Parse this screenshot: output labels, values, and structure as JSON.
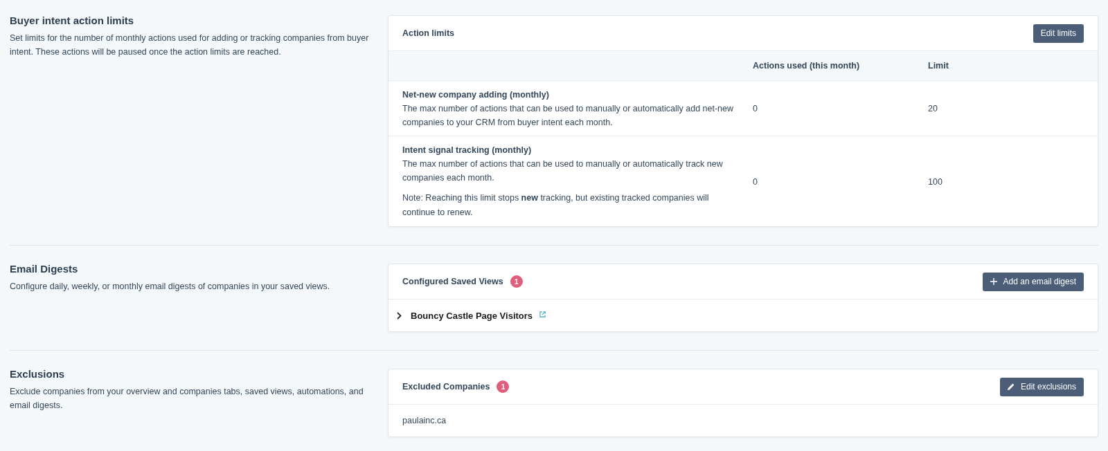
{
  "sections": [
    {
      "kind": "limits",
      "title": "Buyer intent action limits",
      "description": "Set limits for the number of monthly actions used for adding or tracking companies from buyer intent. These actions will be paused once the action limits are reached.",
      "card": {
        "title": "Action limits",
        "button": "Edit limits",
        "columns": [
          "Actions used (this month)",
          "Limit"
        ],
        "rows": [
          {
            "name": "Net-new company adding (monthly)",
            "description": "The max number of actions that can be used to manually or automatically add net-new companies to your CRM from buyer intent each month.",
            "actions_used": "0",
            "limit": "20"
          },
          {
            "name": "Intent signal tracking (monthly)",
            "description": "The max number of actions that can be used to manually or automatically track new companies each month.",
            "note": "Note: Reaching this limit stops **new** tracking, but existing tracked companies will continue to renew.",
            "actions_used": "0",
            "limit": "100"
          }
        ]
      }
    },
    {
      "kind": "digests",
      "title": "Email Digests",
      "description": "Configure daily, weekly, or monthly email digests of companies in your saved views.",
      "card": {
        "title": "Configured Saved Views",
        "badge": "1",
        "button": "Add an email digest",
        "items": [
          {
            "label": "Bouncy Castle Page Visitors",
            "expanded": false
          }
        ]
      }
    },
    {
      "kind": "exclusions",
      "title": "Exclusions",
      "description": "Exclude companies from your overview and companies tabs, saved views, automations, and email digests.",
      "card": {
        "title": "Excluded Companies",
        "badge": "1",
        "button": "Edit exclusions",
        "items": [
          {
            "label": "paulainc.ca"
          }
        ]
      }
    }
  ]
}
